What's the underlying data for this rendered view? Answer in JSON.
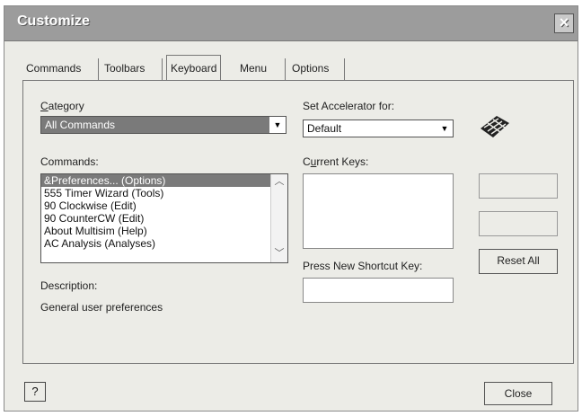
{
  "window": {
    "title": "Customize",
    "close_glyph": "×"
  },
  "tabs": [
    {
      "label": "Commands"
    },
    {
      "label": "Toolbars"
    },
    {
      "label": "Keyboard",
      "active": true
    },
    {
      "label": "Menu"
    },
    {
      "label": "Options"
    }
  ],
  "category": {
    "label": "Category",
    "value": "All Commands"
  },
  "commands": {
    "label": "Commands:",
    "items": [
      {
        "label": "&Preferences... (Options)",
        "selected": true
      },
      {
        "label": "555 Timer Wizard (Tools)"
      },
      {
        "label": "90 Clockwise (Edit)"
      },
      {
        "label": "90 CounterCW (Edit)"
      },
      {
        "label": "About Multisim (Help)"
      },
      {
        "label": "AC Analysis (Analyses)"
      }
    ]
  },
  "description": {
    "label": "Description:",
    "text": "General user preferences"
  },
  "accelerator": {
    "label": "Set Accelerator for:",
    "value": "Default"
  },
  "current_keys": {
    "label": "Current Keys:"
  },
  "new_shortcut": {
    "label": "Press New Shortcut Key:"
  },
  "buttons": {
    "reset_all": "Reset All",
    "close": "Close",
    "help": "?"
  },
  "icons": {
    "keyboard": "keyboard-icon",
    "dropdown": "chevron-down-icon",
    "help": "help-icon"
  }
}
